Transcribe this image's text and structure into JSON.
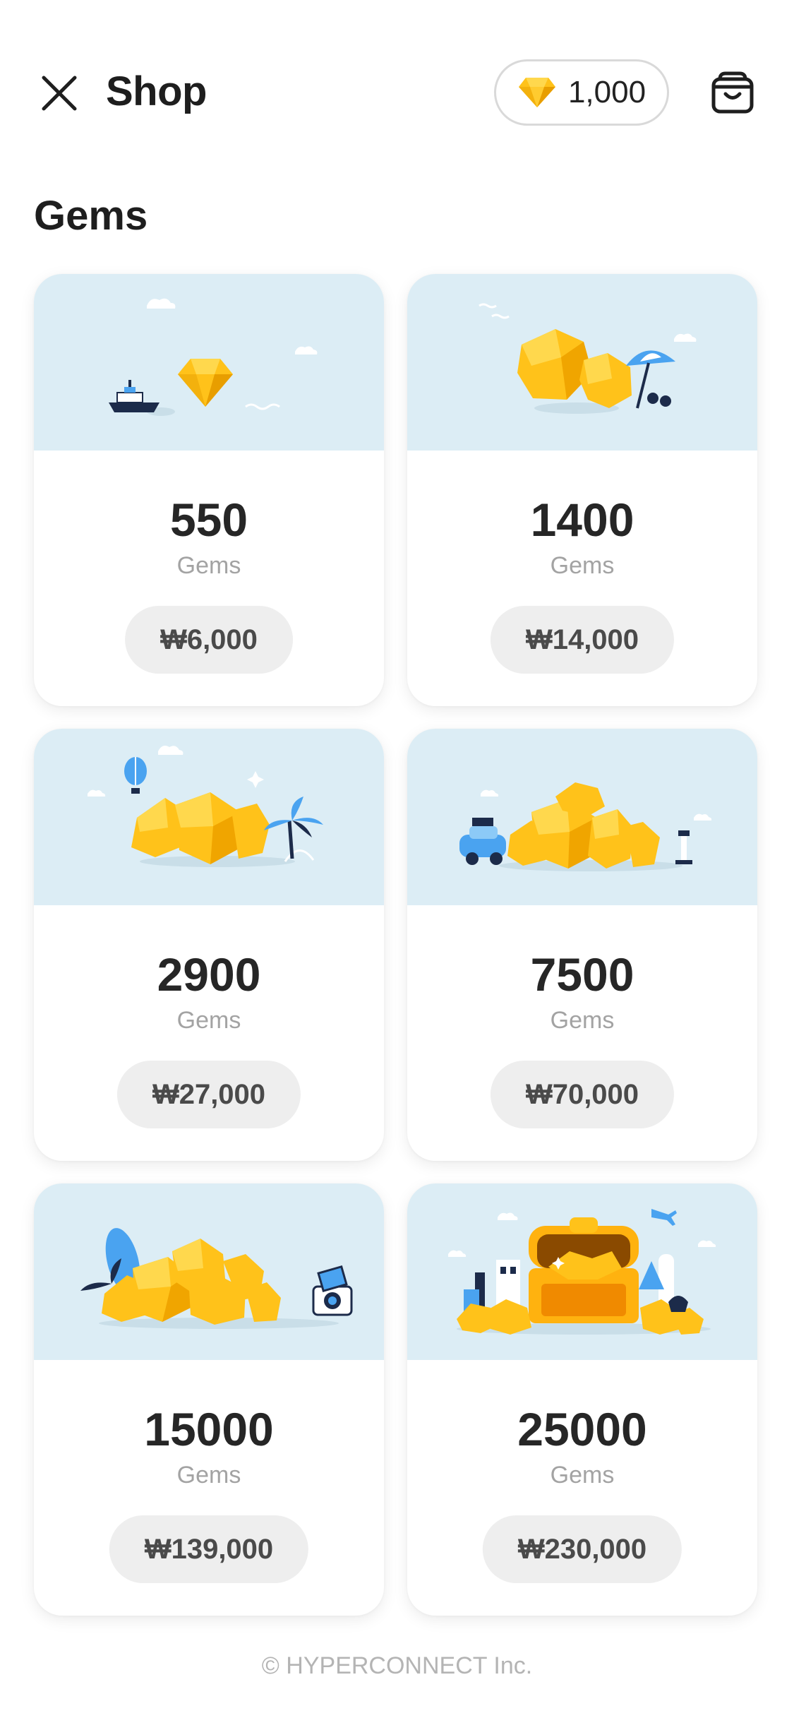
{
  "header": {
    "title": "Shop",
    "gem_balance": "1,000",
    "close_icon": "close-icon",
    "cart_icon": "shopping-bag-icon"
  },
  "section": {
    "title": "Gems"
  },
  "packages": [
    {
      "amount": "550",
      "unit": "Gems",
      "price": "₩6,000",
      "art": "single-gem-with-ship"
    },
    {
      "amount": "1400",
      "unit": "Gems",
      "price": "₩14,000",
      "art": "two-gems-with-umbrella"
    },
    {
      "amount": "2900",
      "unit": "Gems",
      "price": "₩27,000",
      "art": "gem-pile-with-balloon-and-palm"
    },
    {
      "amount": "7500",
      "unit": "Gems",
      "price": "₩70,000",
      "art": "gem-pile-with-car-and-lighthouse"
    },
    {
      "amount": "15000",
      "unit": "Gems",
      "price": "₩139,000",
      "art": "large-gem-pile-with-surfboard-and-camera"
    },
    {
      "amount": "25000",
      "unit": "Gems",
      "price": "₩230,000",
      "art": "treasure-chest-with-city"
    }
  ],
  "footer": {
    "copyright": "© HYPERCONNECT Inc."
  },
  "colors": {
    "art_background": "#dcedf5",
    "gem_gold": "#ffc21a",
    "gem_light": "#ffd84d",
    "gem_dark": "#f0a500",
    "price_pill": "#eeeeee",
    "accent_blue": "#4aa3f0",
    "navy": "#1c2b4a"
  }
}
